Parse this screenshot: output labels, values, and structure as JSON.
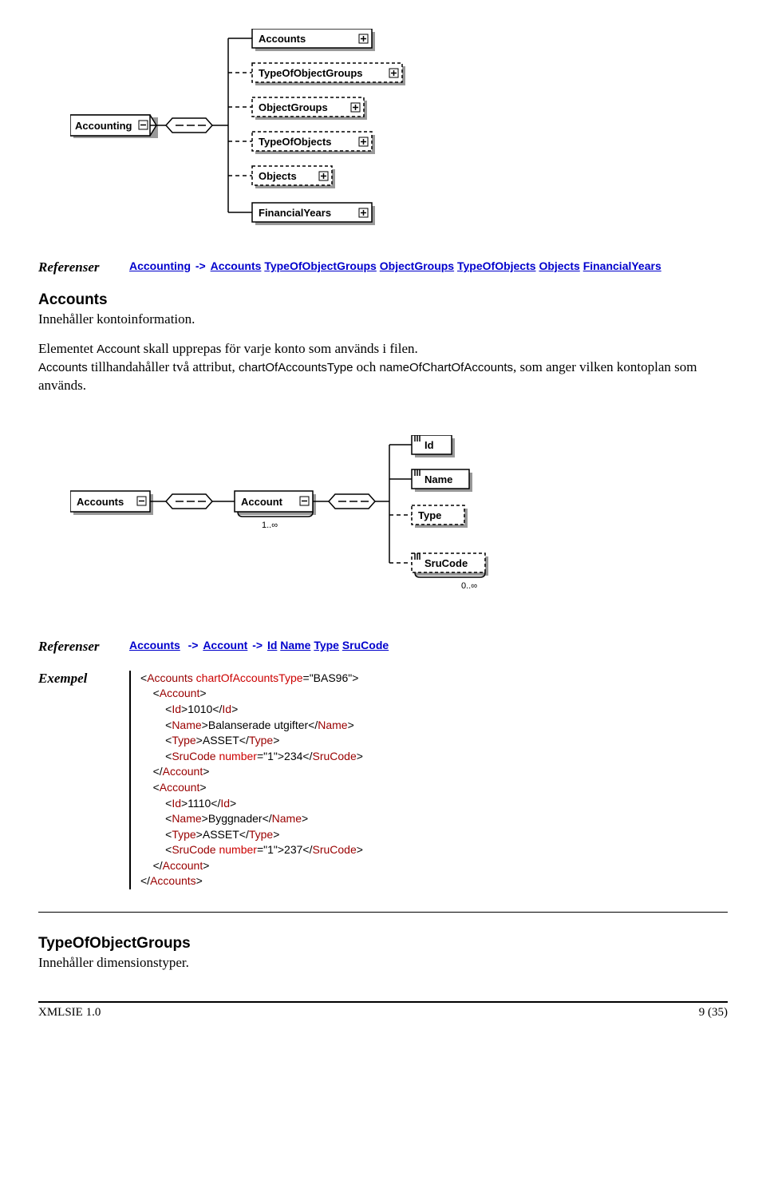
{
  "diagram1": {
    "root": "Accounting",
    "children": [
      "Accounts",
      "TypeOfObjectGroups",
      "ObjectGroups",
      "TypeOfObjects",
      "Objects",
      "FinancialYears"
    ]
  },
  "ref1": {
    "label": "Referenser",
    "links": [
      "Accounting",
      "Accounts",
      "TypeOfObjectGroups",
      "ObjectGroups",
      "TypeOfObjects",
      "Objects",
      "FinancialYears"
    ],
    "arrow": "->"
  },
  "section_accounts": {
    "title": "Accounts",
    "subtitle": "Innehåller kontoinformation.",
    "para1_a": "Elementet ",
    "para1_b": "Account",
    "para1_c": " skall upprepas för varje konto som används i filen.",
    "para2_a": "Accounts",
    "para2_b": " tillhandahåller två attribut, ",
    "para2_c": "chartOfAccountsType",
    "para2_d": " och ",
    "para2_e": "nameOfChartOfAccounts",
    "para2_f": ", som anger vilken kontoplan som används."
  },
  "diagram2": {
    "n0": "Accounts",
    "n1": "Account",
    "r1": "1..∞",
    "children": [
      "Id",
      "Name",
      "Type",
      "SruCode"
    ],
    "r2": "0..∞"
  },
  "ref2": {
    "label": "Referenser",
    "link_accounts": "Accounts",
    "link_account": "Account",
    "links_tail": [
      "Id",
      "Name",
      "Type",
      "SruCode"
    ],
    "arrow": "->"
  },
  "example": {
    "label": "Exempel",
    "xml": {
      "root": "Accounts",
      "root_attr_name": "chartOfAccountsType",
      "root_attr_val": "\"BAS96\"",
      "accounts": [
        {
          "id": "1010",
          "name": "Balanserade utgifter",
          "type": "ASSET",
          "sru_attr_name": "number",
          "sru_attr_val": "\"1\"",
          "sru_text": "234"
        },
        {
          "id": "1110",
          "name": "Byggnader",
          "type": "ASSET",
          "sru_attr_name": "number",
          "sru_attr_val": "\"1\"",
          "sru_text": "237"
        }
      ]
    }
  },
  "section_toog": {
    "title": "TypeOfObjectGroups",
    "subtitle": "Innehåller dimensionstyper."
  },
  "footer": {
    "left": "XMLSIE 1.0",
    "right": "9 (35)"
  }
}
